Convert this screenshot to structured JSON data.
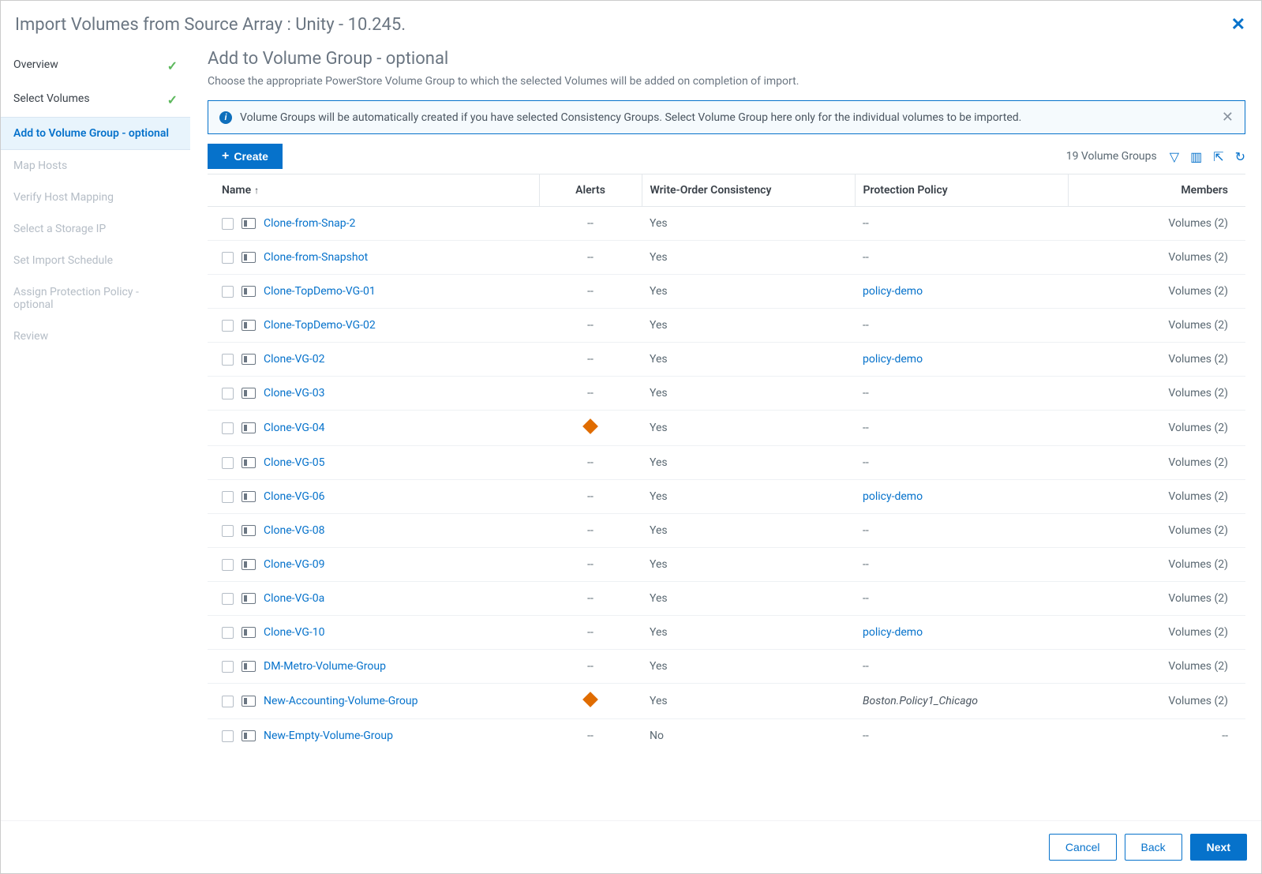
{
  "dialog": {
    "title": "Import Volumes from Source Array : Unity - 10.245."
  },
  "sidebar": {
    "steps": [
      {
        "label": "Overview",
        "state": "done"
      },
      {
        "label": "Select Volumes",
        "state": "done"
      },
      {
        "label": "Add to Volume Group - optional",
        "state": "active"
      },
      {
        "label": "Map Hosts",
        "state": "pending"
      },
      {
        "label": "Verify Host Mapping",
        "state": "pending"
      },
      {
        "label": "Select a Storage IP",
        "state": "pending"
      },
      {
        "label": "Set Import Schedule",
        "state": "pending"
      },
      {
        "label": "Assign Protection Policy - optional",
        "state": "pending"
      },
      {
        "label": "Review",
        "state": "pending"
      }
    ]
  },
  "page": {
    "title": "Add to Volume Group - optional",
    "description": "Choose the appropriate PowerStore Volume Group to which the selected Volumes will be added on completion of import.",
    "banner": "Volume Groups will be automatically created if you have selected Consistency Groups. Select Volume Group here only for the individual volumes to be imported.",
    "create_label": "Create",
    "count_text": "19 Volume Groups"
  },
  "table": {
    "headers": {
      "name": "Name",
      "alerts": "Alerts",
      "woc": "Write-Order Consistency",
      "policy": "Protection Policy",
      "members": "Members"
    },
    "rows": [
      {
        "name": "Clone-from-Snap-2",
        "alerts": "--",
        "woc": "Yes",
        "policy": "--",
        "policy_type": "dash",
        "members": "Volumes (2)"
      },
      {
        "name": "Clone-from-Snapshot",
        "alerts": "--",
        "woc": "Yes",
        "policy": "--",
        "policy_type": "dash",
        "members": "Volumes (2)"
      },
      {
        "name": "Clone-TopDemo-VG-01",
        "alerts": "--",
        "woc": "Yes",
        "policy": "policy-demo",
        "policy_type": "link",
        "members": "Volumes (2)"
      },
      {
        "name": "Clone-TopDemo-VG-02",
        "alerts": "--",
        "woc": "Yes",
        "policy": "--",
        "policy_type": "dash",
        "members": "Volumes (2)"
      },
      {
        "name": "Clone-VG-02",
        "alerts": "--",
        "woc": "Yes",
        "policy": "policy-demo",
        "policy_type": "link",
        "members": "Volumes (2)"
      },
      {
        "name": "Clone-VG-03",
        "alerts": "--",
        "woc": "Yes",
        "policy": "--",
        "policy_type": "dash",
        "members": "Volumes (2)"
      },
      {
        "name": "Clone-VG-04",
        "alerts": "warn",
        "woc": "Yes",
        "policy": "--",
        "policy_type": "dash",
        "members": "Volumes (2)"
      },
      {
        "name": "Clone-VG-05",
        "alerts": "--",
        "woc": "Yes",
        "policy": "--",
        "policy_type": "dash",
        "members": "Volumes (2)"
      },
      {
        "name": "Clone-VG-06",
        "alerts": "--",
        "woc": "Yes",
        "policy": "policy-demo",
        "policy_type": "link",
        "members": "Volumes (2)"
      },
      {
        "name": "Clone-VG-08",
        "alerts": "--",
        "woc": "Yes",
        "policy": "--",
        "policy_type": "dash",
        "members": "Volumes (2)"
      },
      {
        "name": "Clone-VG-09",
        "alerts": "--",
        "woc": "Yes",
        "policy": "--",
        "policy_type": "dash",
        "members": "Volumes (2)"
      },
      {
        "name": "Clone-VG-0a",
        "alerts": "--",
        "woc": "Yes",
        "policy": "--",
        "policy_type": "dash",
        "members": "Volumes (2)"
      },
      {
        "name": "Clone-VG-10",
        "alerts": "--",
        "woc": "Yes",
        "policy": "policy-demo",
        "policy_type": "link",
        "members": "Volumes (2)"
      },
      {
        "name": "DM-Metro-Volume-Group",
        "alerts": "--",
        "woc": "Yes",
        "policy": "--",
        "policy_type": "dash",
        "members": "Volumes (2)"
      },
      {
        "name": "New-Accounting-Volume-Group",
        "alerts": "warn",
        "woc": "Yes",
        "policy": "Boston.Policy1_Chicago",
        "policy_type": "italic",
        "members": "Volumes (2)"
      },
      {
        "name": "New-Empty-Volume-Group",
        "alerts": "--",
        "woc": "No",
        "policy": "--",
        "policy_type": "dash",
        "members": "--"
      }
    ]
  },
  "footer": {
    "cancel": "Cancel",
    "back": "Back",
    "next": "Next"
  }
}
